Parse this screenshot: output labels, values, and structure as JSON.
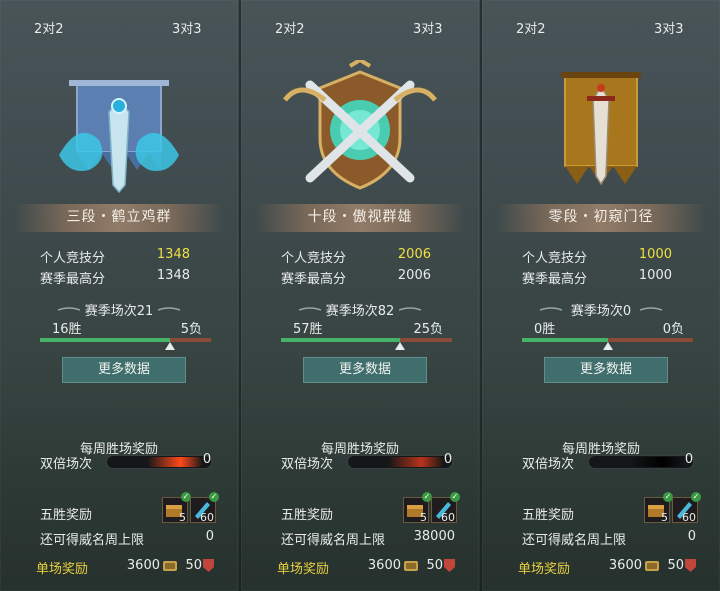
{
  "cards": [
    {
      "tabs": {
        "two_v_two": "2对2",
        "three_v_three": "3对3"
      },
      "emblem": "blue-dragon-sword-banner",
      "rank_title": "三段・鹤立鸡群",
      "stats": {
        "score_label": "个人竞技分",
        "score_value": "1348",
        "best_label": "赛季最高分",
        "best_value": "1348"
      },
      "season": {
        "title": "赛季场次21",
        "wins": "16胜",
        "losses": "5负",
        "win_ratio": 0.76
      },
      "more_label": "更多数据",
      "weekly": {
        "title": "每周胜场奖励",
        "double_label": "双倍场次",
        "double_count": "0",
        "glow_color": "#ff4a1a"
      },
      "five_win": {
        "label": "五胜奖励",
        "item1_count": "5",
        "item2_count": "60"
      },
      "cap": {
        "label": "还可得威名周上限",
        "value": "0"
      },
      "single": {
        "label": "单场奖励",
        "coins": "3600",
        "honor": "50"
      }
    },
    {
      "tabs": {
        "two_v_two": "2对2",
        "three_v_three": "3对3"
      },
      "emblem": "golden-crossed-swords-shield",
      "rank_title": "十段・傲视群雄",
      "stats": {
        "score_label": "个人竞技分",
        "score_value": "2006",
        "best_label": "赛季最高分",
        "best_value": "2006"
      },
      "season": {
        "title": "赛季场次82",
        "wins": "57胜",
        "losses": "25负",
        "win_ratio": 0.695
      },
      "more_label": "更多数据",
      "weekly": {
        "title": "每周胜场奖励",
        "double_label": "双倍场次",
        "double_count": "0",
        "glow_color": "#b8331a"
      },
      "five_win": {
        "label": "五胜奖励",
        "item1_count": "5",
        "item2_count": "60"
      },
      "cap": {
        "label": "还可得威名周上限",
        "value": "38000"
      },
      "single": {
        "label": "单场奖励",
        "coins": "3600",
        "honor": "50"
      }
    },
    {
      "tabs": {
        "two_v_two": "2对2",
        "three_v_three": "3对3"
      },
      "emblem": "brown-banner-sword",
      "rank_title": "零段・初窥门径",
      "stats": {
        "score_label": "个人竞技分",
        "score_value": "1000",
        "best_label": "赛季最高分",
        "best_value": "1000"
      },
      "season": {
        "title": "赛季场次0",
        "wins": "0胜",
        "losses": "0负",
        "win_ratio": 0.5
      },
      "more_label": "更多数据",
      "weekly": {
        "title": "每周胜场奖励",
        "double_label": "双倍场次",
        "double_count": "0",
        "glow_color": "#000000"
      },
      "five_win": {
        "label": "五胜奖励",
        "item1_count": "5",
        "item2_count": "60"
      },
      "cap": {
        "label": "还可得威名周上限",
        "value": "0"
      },
      "single": {
        "label": "单场奖励",
        "coins": "3600",
        "honor": "50"
      }
    }
  ],
  "colors": {
    "score_highlight": "#f0e040",
    "win_bar": "#45b36a",
    "loss_bar": "#8a4a38",
    "single_reward_label": "#e8d040",
    "button_bg": "#3f6e6c"
  }
}
